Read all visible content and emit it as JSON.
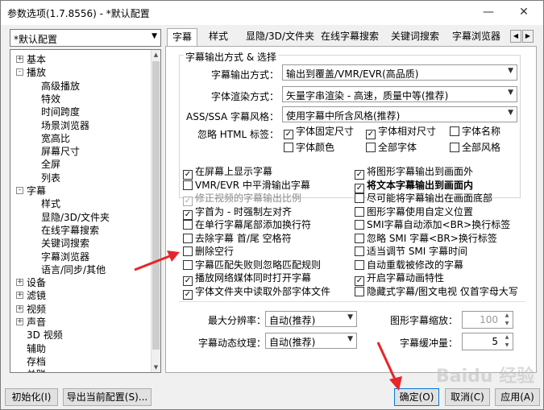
{
  "window": {
    "title": "参数选项(1.7.8556) - *默认配置",
    "controls": [
      "—",
      "☐",
      "✕"
    ]
  },
  "preset": {
    "value": "*默认配置"
  },
  "tree": {
    "items": [
      {
        "label": "基本",
        "level": 0,
        "expander": "+"
      },
      {
        "label": "播放",
        "level": 0,
        "expander": "-"
      },
      {
        "label": "高级播放",
        "level": 1
      },
      {
        "label": "特效",
        "level": 1
      },
      {
        "label": "时间跨度",
        "level": 1
      },
      {
        "label": "场景浏览器",
        "level": 1
      },
      {
        "label": "宽高比",
        "level": 1
      },
      {
        "label": "屏幕尺寸",
        "level": 1
      },
      {
        "label": "全屏",
        "level": 1
      },
      {
        "label": "列表",
        "level": 1
      },
      {
        "label": "字幕",
        "level": 0,
        "expander": "-"
      },
      {
        "label": "样式",
        "level": 1
      },
      {
        "label": "显隐/3D/文件夹",
        "level": 1
      },
      {
        "label": "在线字幕搜索",
        "level": 1
      },
      {
        "label": "关键词搜索",
        "level": 1
      },
      {
        "label": "字幕浏览器",
        "level": 1
      },
      {
        "label": "语言/同步/其他",
        "level": 1
      },
      {
        "label": "设备",
        "level": 0,
        "expander": "+"
      },
      {
        "label": "滤镜",
        "level": 0,
        "expander": "+"
      },
      {
        "label": "视频",
        "level": 0,
        "expander": "+"
      },
      {
        "label": "声音",
        "level": 0,
        "expander": "+"
      },
      {
        "label": "3D 视频",
        "level": 0
      },
      {
        "label": "辅助",
        "level": 0
      },
      {
        "label": "存档",
        "level": 0
      },
      {
        "label": "关联",
        "level": 0
      }
    ]
  },
  "tabs": [
    "字幕",
    "样式",
    "显隐/3D/文件夹",
    "在线字幕搜索",
    "关键词搜索",
    "字幕浏览器"
  ],
  "tab_nav": [
    "◀",
    "▶"
  ],
  "output_group": {
    "title": "字幕输出方式 & 选择",
    "output_label": "字幕输出方式：",
    "output_value": "输出到覆盖/VMR/EVR(高品质)",
    "render_label": "字体渲染方式：",
    "render_value": "矢量字串渲染 - 高速，质量中等(推荐)",
    "ass_label": "ASS/SSA 字幕风格：",
    "ass_value": "使用字幕中所含风格(推荐)",
    "html_label": "忽略 HTML 标签：",
    "html_tags": [
      {
        "label": "字体固定尺寸",
        "checked": true
      },
      {
        "label": "字体相对尺寸",
        "checked": true
      },
      {
        "label": "字体名称",
        "checked": false
      },
      {
        "label": "字体颜色",
        "checked": false
      },
      {
        "label": "全部字体",
        "checked": false
      },
      {
        "label": "全部风格",
        "checked": false
      }
    ]
  },
  "options_left": [
    {
      "label": "在屏幕上显示字幕",
      "checked": true
    },
    {
      "label": "VMR/EVR 中平滑输出字幕",
      "checked": false
    },
    {
      "label": "修正视频的字幕输出比例",
      "checked": true,
      "disabled": true
    },
    {
      "label": "字首为 - 时强制左对齐",
      "checked": true
    },
    {
      "label": "在单行字幕尾部添加换行符",
      "checked": false
    },
    {
      "label": "去除字幕 首/尾 空格符",
      "checked": false
    },
    {
      "label": "删除空行",
      "checked": false
    },
    {
      "label": "字幕匹配失败则忽略匹配规则",
      "checked": false
    },
    {
      "label": "播放网络媒体同时打开字幕",
      "checked": true
    },
    {
      "label": "字体文件夹中读取外部字体文件",
      "checked": true
    }
  ],
  "options_right": [
    {
      "label": "将图形字幕输出到画面外",
      "checked": true
    },
    {
      "label": "将文本字幕输出到画面内",
      "checked": true,
      "bold": true
    },
    {
      "label": "尽可能将字幕输出在画面底部",
      "checked": false
    },
    {
      "label": "图形字幕使用自定义位置",
      "checked": false
    },
    {
      "label": "SMI字幕自动添加<BR>换行标签",
      "checked": false
    },
    {
      "label": "忽略 SMI 字幕<BR>换行标签",
      "checked": false
    },
    {
      "label": "适当调节 SMI 字幕时间",
      "checked": false
    },
    {
      "label": "自动重载被修改的字幕",
      "checked": false
    },
    {
      "label": "开启字幕动画特性",
      "checked": true
    },
    {
      "label": "隐藏式字幕/图文电视 仅首字母大写",
      "checked": false
    }
  ],
  "bottom": {
    "max_res_label": "最大分辨率：",
    "max_res_value": "自动(推荐)",
    "texture_label": "字幕动态纹理：",
    "texture_value": "自动(推荐)",
    "zoom_label": "图形字幕缩放：",
    "zoom_value": "100",
    "buffer_label": "字幕缓冲量：",
    "buffer_value": "5"
  },
  "buttons": {
    "init": "初始化(I)",
    "export": "导出当前配置(S)...",
    "ok": "确定(O)",
    "cancel": "取消(C)",
    "apply": "应用(A)"
  },
  "watermark": "Baidu 经验",
  "colors": {
    "annotation_arrow": "#e8242b",
    "accent": "#0078d7"
  }
}
